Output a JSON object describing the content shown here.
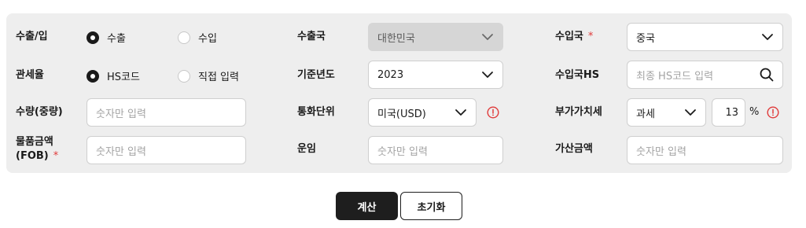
{
  "row1": {
    "trade_label": "수출/입",
    "export_label": "수출",
    "import_label": "수입",
    "export_country_label": "수출국",
    "export_country_value": "대한민국",
    "import_country_label": "수입국",
    "import_country_required": "*",
    "import_country_value": "중국"
  },
  "row2": {
    "tariff_label": "관세율",
    "hscode_label": "HS코드",
    "direct_label": "직접 입력",
    "base_year_label": "기준년도",
    "base_year_value": "2023",
    "import_hs_label": "수입국HS",
    "import_hs_placeholder": "최종 HS코드 입력"
  },
  "row3": {
    "quantity_label": "수량(중량)",
    "quantity_placeholder": "숫자만 입력",
    "currency_label": "통화단위",
    "currency_value": "미국(USD)",
    "vat_label": "부가가치세",
    "vat_type_value": "과세",
    "vat_rate_value": "13",
    "vat_unit": "%"
  },
  "row4": {
    "goods_amount_label_line1": "물품금액",
    "goods_amount_label_line2": "(FOB)",
    "goods_amount_required": "*",
    "goods_amount_placeholder": "숫자만 입력",
    "freight_label": "운임",
    "freight_placeholder": "숫자만 입력",
    "added_amount_label": "가산금액",
    "added_amount_placeholder": "숫자만 입력"
  },
  "actions": {
    "calculate_label": "계산",
    "reset_label": "초기화"
  },
  "colors": {
    "required": "#e03a3a",
    "primary_button": "#1e1e1e",
    "panel_bg": "#eeeeee"
  }
}
